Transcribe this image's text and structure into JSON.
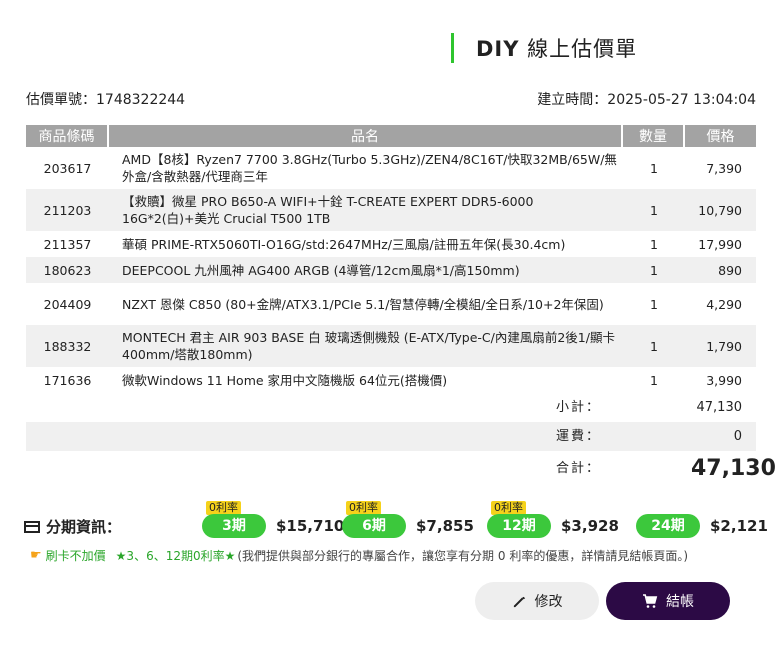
{
  "header": {
    "title_diy": "DIY",
    "title_rest": " 線上估價單",
    "accent_color": "#2fc52f"
  },
  "meta": {
    "quote_no": "估價單號：1748322244",
    "created": "建立時間：2025-05-27 13:04:04"
  },
  "table": {
    "headers": [
      "商品條碼",
      "品名",
      "數量",
      "價格"
    ],
    "rows": [
      {
        "code": "203617",
        "name": "AMD【8核】Ryzen7 7700 3.8GHz(Turbo 5.3GHz)/ZEN4/8C16T/快取32MB/65W/無外盒/含散熱器/代理商三年",
        "qty": "1",
        "price": "7,390"
      },
      {
        "code": "211203",
        "name": "【救贖】微星 PRO B650-A WIFI+十銓 T-CREATE EXPERT DDR5-6000 16G*2(白)+美光 Crucial T500 1TB",
        "qty": "1",
        "price": "10,790"
      },
      {
        "code": "211357",
        "name": "華碩 PRIME-RTX5060TI-O16G/std:2647MHz/三風扇/註冊五年保(長30.4cm)",
        "qty": "1",
        "price": "17,990"
      },
      {
        "code": "180623",
        "name": "DEEPCOOL 九州風神 AG400 ARGB (4導管/12cm風扇*1/高150mm)",
        "qty": "1",
        "price": "890"
      },
      {
        "code": "204409",
        "name": "NZXT 恩傑 C850 (80+金牌/ATX3.1/PCIe 5.1/智慧停轉/全模組/全日系/10+2年保固)",
        "qty": "1",
        "price": "4,290"
      },
      {
        "code": "188332",
        "name": "MONTECH 君主 AIR 903 BASE 白 玻璃透側機殼 (E-ATX/Type-C/內建風扇前2後1/顯卡400mm/塔散180mm)",
        "qty": "1",
        "price": "1,790"
      },
      {
        "code": "171636",
        "name": "微軟Windows 11 Home 家用中文隨機版 64位元(搭機價)",
        "qty": "1",
        "price": "3,990"
      }
    ]
  },
  "summary": {
    "subtotal_label": "小計：",
    "subtotal_value": "47,130",
    "shipping_label": "運費：",
    "shipping_value": "0",
    "total_label": "合計：",
    "total_value": "47,130"
  },
  "installment": {
    "label": "分期資訊：",
    "plans": [
      {
        "badge": "0利率",
        "term": "3期",
        "amount": "$15,710"
      },
      {
        "badge": "0利率",
        "term": "6期",
        "amount": "$7,855"
      },
      {
        "badge": "0利率",
        "term": "12期",
        "amount": "$3,928"
      },
      {
        "badge": "",
        "term": "24期",
        "amount": "$2,121"
      }
    ]
  },
  "notice": {
    "part1": "刷卡不加價",
    "part2": "★3、6、12期0利率★",
    "part3": "(我們提供與部分銀行的專屬合作，讓您享有分期 0 利率的優惠，詳情請見結帳頁面。)"
  },
  "buttons": {
    "edit": "修改",
    "checkout": "結帳"
  }
}
